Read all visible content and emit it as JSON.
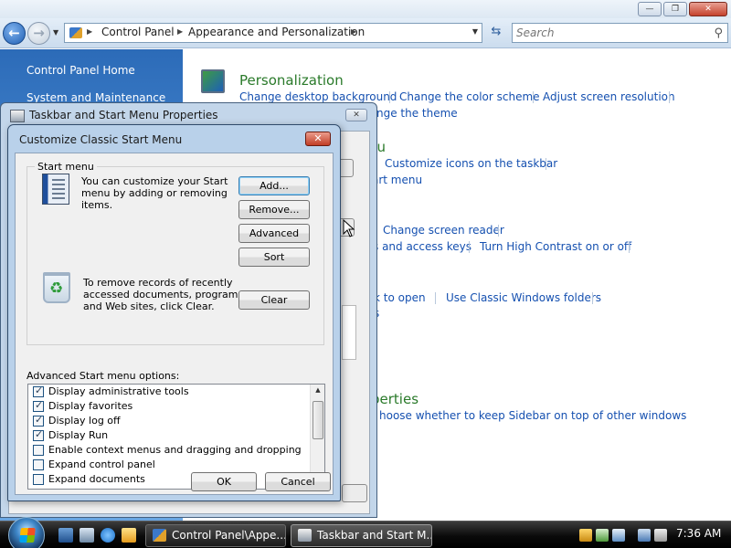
{
  "window": {
    "search_placeholder": "Search",
    "breadcrumbs": [
      "Control Panel",
      "Appearance and Personalization"
    ]
  },
  "sidebar": {
    "home": "Control Panel Home",
    "item": "System and Maintenance"
  },
  "main": {
    "personalization_heading": "Personalization",
    "link_desktop_bg": "Change desktop background",
    "link_color_scheme": "Change the color scheme",
    "link_resolution": "Adjust screen resolution",
    "link_theme": "nge the theme",
    "heading_taskbar": "nu",
    "link_customize_icons": "Customize icons on the taskbar",
    "link_start_menu": "art menu",
    "link_screen_reader": "Change screen reader",
    "link_access_keys": "s and access keys",
    "link_high_contrast": "Turn High Contrast on or off",
    "link_click_open": "k to open",
    "link_classic_folders": "Use Classic Windows folders",
    "link_s": "s",
    "heading_sidebar": "perties",
    "link_sidebar_top": "hoose whether to keep Sidebar on top of other windows"
  },
  "taskbar_dialog": {
    "title": "Taskbar and Start Menu Properties",
    "close": "✕"
  },
  "customize_dialog": {
    "title": "Customize Classic Start Menu",
    "close": "✕",
    "group_label": "Start menu",
    "desc_customize": "You can customize your Start\nmenu by adding or removing\nitems.",
    "desc_clear": "To remove records of recently\naccessed documents, programs,\nand Web sites, click Clear.",
    "btn_add": "Add...",
    "btn_remove": "Remove...",
    "btn_advanced": "Advanced",
    "btn_sort": "Sort",
    "btn_clear": "Clear",
    "advanced_label": "Advanced Start menu options:",
    "options": [
      {
        "label": "Display administrative tools",
        "checked": true
      },
      {
        "label": "Display favorites",
        "checked": true
      },
      {
        "label": "Display log off",
        "checked": true
      },
      {
        "label": "Display Run",
        "checked": true
      },
      {
        "label": "Enable context menus and dragging and dropping",
        "checked": false
      },
      {
        "label": "Expand control panel",
        "checked": false
      },
      {
        "label": "Expand documents",
        "checked": false
      }
    ],
    "btn_ok": "OK",
    "btn_cancel": "Cancel"
  },
  "taskbar": {
    "task1": "Control Panel\\Appe...",
    "task2": "Taskbar and Start M...",
    "clock": "7:36 AM"
  },
  "colors": {
    "link": "#1550b0",
    "heading": "#2a7a2a",
    "sidebar": "#3b7ac6"
  }
}
